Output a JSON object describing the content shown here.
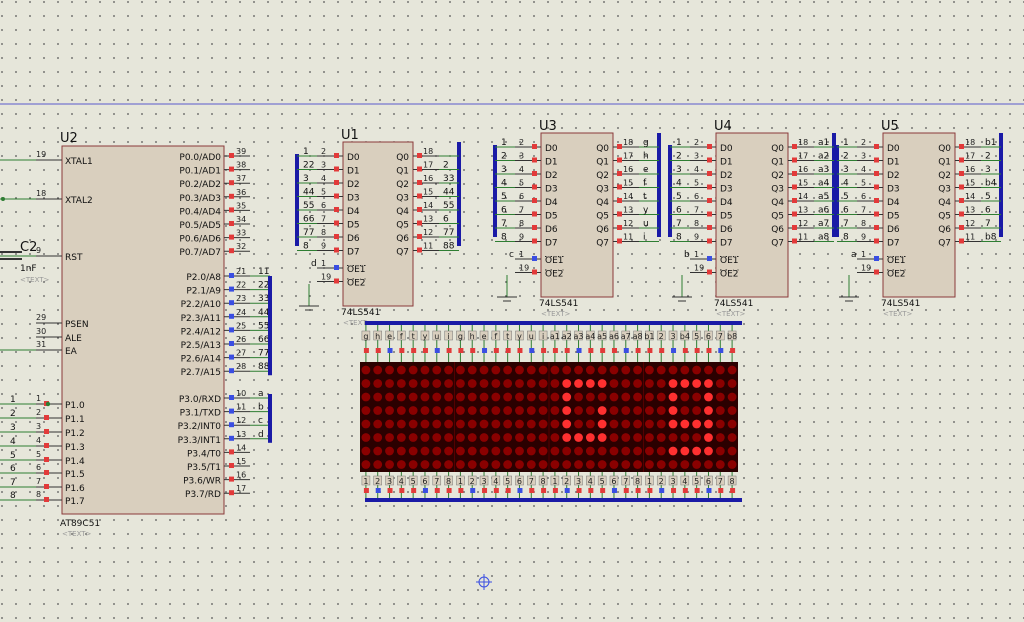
{
  "colors": {
    "background": "#e6e6da",
    "chip_fill": "#d9cfbe",
    "chip_border": "#8b3a3a",
    "bus": "#1a1aa6",
    "wire": "#2e7d32",
    "pin_red": "#e23a3a",
    "pin_blue": "#3a4ee2",
    "led_on": "#ff3030",
    "led_off": "#8a0000",
    "matrix_bg": "#2b0000"
  },
  "cursor_icon": "crosshair-icon",
  "u2": {
    "ref": "U2",
    "part": "AT89C51",
    "tag": "<TEXT>",
    "left_pins": [
      {
        "num": "19",
        "label": "XTAL1"
      },
      {
        "num": "18",
        "label": "XTAL2"
      },
      {
        "num": "9",
        "label": "RST"
      },
      {
        "num": "29",
        "label": "PSEN"
      },
      {
        "num": "30",
        "label": "ALE"
      },
      {
        "num": "31",
        "label": "EA"
      },
      {
        "num": "1",
        "label": "P1.0"
      },
      {
        "num": "2",
        "label": "P1.1"
      },
      {
        "num": "3",
        "label": "P1.2"
      },
      {
        "num": "4",
        "label": "P1.3"
      },
      {
        "num": "5",
        "label": "P1.4"
      },
      {
        "num": "6",
        "label": "P1.5"
      },
      {
        "num": "7",
        "label": "P1.6"
      },
      {
        "num": "8",
        "label": "P1.7"
      }
    ],
    "right_pins": [
      {
        "num": "39",
        "label": "P0.0/AD0"
      },
      {
        "num": "38",
        "label": "P0.1/AD1"
      },
      {
        "num": "37",
        "label": "P0.2/AD2"
      },
      {
        "num": "36",
        "label": "P0.3/AD3"
      },
      {
        "num": "35",
        "label": "P0.4/AD4"
      },
      {
        "num": "34",
        "label": "P0.5/AD5"
      },
      {
        "num": "33",
        "label": "P0.6/AD6"
      },
      {
        "num": "32",
        "label": "P0.7/AD7"
      },
      {
        "num": "21",
        "label": "P2.0/A8"
      },
      {
        "num": "22",
        "label": "P2.1/A9"
      },
      {
        "num": "23",
        "label": "P2.2/A10"
      },
      {
        "num": "24",
        "label": "P2.3/A11"
      },
      {
        "num": "25",
        "label": "P2.4/A12"
      },
      {
        "num": "26",
        "label": "P2.5/A13"
      },
      {
        "num": "27",
        "label": "P2.6/A14"
      },
      {
        "num": "28",
        "label": "P2.7/A15"
      },
      {
        "num": "10",
        "label": "P3.0/RXD"
      },
      {
        "num": "11",
        "label": "P3.1/TXD"
      },
      {
        "num": "12",
        "label": "P3.2/INT0"
      },
      {
        "num": "13",
        "label": "P3.3/INT1"
      },
      {
        "num": "14",
        "label": "P3.4/T0"
      },
      {
        "num": "15",
        "label": "P3.5/T1"
      },
      {
        "num": "16",
        "label": "P3.6/WR"
      },
      {
        "num": "17",
        "label": "P3.7/RD"
      }
    ],
    "p2_nets": [
      "11",
      "22",
      "33",
      "44",
      "55",
      "66",
      "77",
      "88"
    ],
    "p3_nets": [
      "a",
      "b",
      "c",
      "d"
    ],
    "p1_nets": [
      "1",
      "2",
      "3",
      "4",
      "5",
      "6",
      "7",
      "8"
    ]
  },
  "capacitor": {
    "ref": "C2",
    "value": "1nF",
    "tag": "<TEXT>"
  },
  "buffers": [
    {
      "ref": "U1",
      "part": "74LS541",
      "tag": "<TEXT>",
      "in_pins": [
        "2",
        "3",
        "4",
        "5",
        "6",
        "7",
        "8",
        "9"
      ],
      "out_pins": [
        "18",
        "17",
        "16",
        "15",
        "14",
        "13",
        "12",
        "11"
      ],
      "in_nets": [
        "1",
        "22",
        "3",
        "44",
        "55",
        "66",
        "77",
        "8"
      ],
      "out_nets": [
        "",
        "2",
        "33",
        "44",
        "55",
        "6",
        "77",
        "88"
      ],
      "oe_pins": [
        "1",
        "19"
      ],
      "oe_nets": [
        "d",
        "",
        ""
      ]
    },
    {
      "ref": "U3",
      "part": "74LS541",
      "tag": "<TEXT>",
      "in_pins": [
        "2",
        "3",
        "4",
        "5",
        "6",
        "7",
        "8",
        "9"
      ],
      "out_pins": [
        "18",
        "17",
        "16",
        "15",
        "14",
        "13",
        "12",
        "11"
      ],
      "in_nets": [
        "1",
        "2",
        "3",
        "4",
        "5",
        "6",
        "7",
        "8"
      ],
      "out_nets": [
        "g",
        "h",
        "e",
        "f",
        "t",
        "y",
        "u",
        "i"
      ],
      "oe_pins": [
        "1",
        "19"
      ],
      "oe_nets": [
        "c",
        "",
        ""
      ]
    },
    {
      "ref": "U4",
      "part": "74LS541",
      "tag": "<TEXT>",
      "in_pins": [
        "2",
        "3",
        "4",
        "5",
        "6",
        "7",
        "8",
        "9"
      ],
      "out_pins": [
        "18",
        "17",
        "16",
        "15",
        "14",
        "13",
        "12",
        "11"
      ],
      "in_nets": [
        "1",
        "2",
        "3",
        "4",
        "5",
        "6",
        "7",
        "8"
      ],
      "out_nets": [
        "a1",
        "a2",
        "a3",
        "a4",
        "a5",
        "a6",
        "a7",
        "a8"
      ],
      "oe_pins": [
        "1",
        "19"
      ],
      "oe_nets": [
        "b",
        "",
        ""
      ]
    },
    {
      "ref": "U5",
      "part": "74LS541",
      "tag": "<TEXT>",
      "in_pins": [
        "2",
        "3",
        "4",
        "5",
        "6",
        "7",
        "8",
        "9"
      ],
      "out_pins": [
        "18",
        "17",
        "16",
        "15",
        "14",
        "13",
        "12",
        "11"
      ],
      "in_nets": [
        "1",
        "2",
        "3",
        "4",
        "5",
        "6",
        "7",
        "8"
      ],
      "out_nets": [
        "b1",
        "2",
        "3",
        "b4",
        "5",
        "6",
        "7",
        "b8"
      ],
      "oe_pins": [
        "1",
        "19"
      ],
      "oe_nets": [
        "a",
        "",
        ""
      ]
    }
  ],
  "buffer_labels": {
    "inputs": [
      "D0",
      "D1",
      "D2",
      "D3",
      "D4",
      "D5",
      "D6",
      "D7"
    ],
    "outputs": [
      "Q0",
      "Q1",
      "Q2",
      "Q3",
      "Q4",
      "Q5",
      "Q6",
      "Q7"
    ],
    "oe": [
      "OE1",
      "OE2"
    ]
  },
  "matrix": {
    "rows": 8,
    "cols": 32,
    "top_pins": [
      "g",
      "h",
      "e",
      "f",
      "t",
      "y",
      "u",
      "i",
      "g",
      "h",
      "e",
      "f",
      "t",
      "y",
      "u",
      "i",
      "a1",
      "a2",
      "a3",
      "a4",
      "a5",
      "a6",
      "a7",
      "a8",
      "b1",
      "2",
      "3",
      "b4",
      "5",
      "6",
      "7",
      "b8"
    ],
    "bottom_pins": [
      "1",
      "2",
      "3",
      "4",
      "5",
      "6",
      "7",
      "8",
      "1",
      "2",
      "3",
      "4",
      "5",
      "6",
      "7",
      "8",
      "1",
      "2",
      "3",
      "4",
      "5",
      "6",
      "7",
      "8",
      "1",
      "2",
      "3",
      "4",
      "5",
      "6",
      "7",
      "8"
    ],
    "lit_rows": [
      "00000000000000000000000000000000",
      "00000000000000000111100000111100",
      "00000000000000000100000000100100",
      "00000000000000000100100000100100",
      "00000000000000000100100000111100",
      "00000000000000000111100000000100",
      "00000000000000000000000000111100",
      "00000000000000000000000000000000"
    ]
  }
}
